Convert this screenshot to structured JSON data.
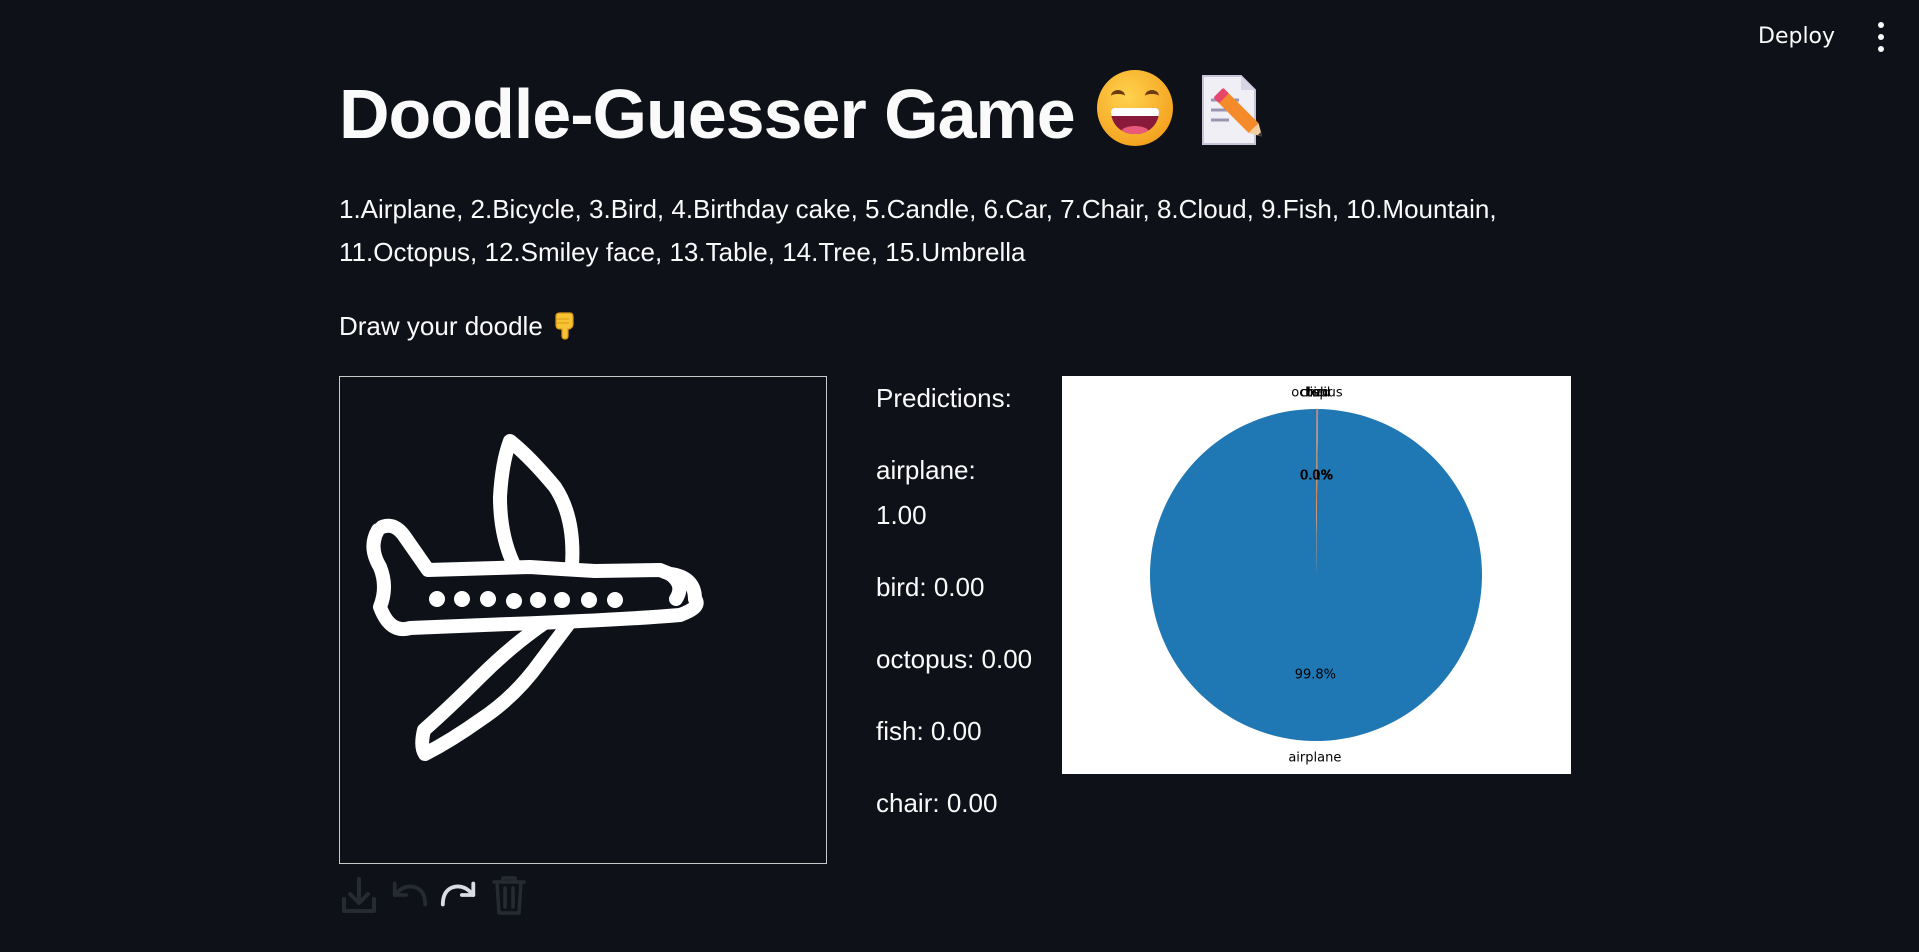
{
  "header": {
    "deploy_label": "Deploy",
    "menu_icon": "vertical-ellipsis-icon"
  },
  "main": {
    "title": "Doodle-Guesser Game",
    "title_emojis": [
      "grinning-face-icon",
      "memo-icon"
    ],
    "classes_text": "1.Airplane, 2.Bicycle, 3.Bird, 4.Birthday cake, 5.Candle, 6.Car, 7.Chair, 8.Cloud, 9.Fish, 10.Mountain, 11.Octopus, 12.Smiley face, 13.Table, 14.Tree, 15.Umbrella",
    "draw_label": "Draw your doodle",
    "draw_emoji": "pointing-down-icon"
  },
  "toolbar": {
    "icons": [
      "download-icon",
      "undo-icon",
      "redo-icon",
      "trash-icon"
    ]
  },
  "predictions": {
    "heading": "Predictions:",
    "items": [
      {
        "label": "airplane:",
        "value": "1.00"
      },
      {
        "label": "bird:",
        "value": "0.00"
      },
      {
        "label": "octopus:",
        "value": "0.00"
      },
      {
        "label": "fish:",
        "value": "0.00"
      },
      {
        "label": "chair:",
        "value": "0.00"
      }
    ]
  },
  "chart_data": {
    "type": "pie",
    "slices": [
      {
        "label": "airplane",
        "value": 99.8,
        "pct_label": "99.8%",
        "color": "#1f77b4"
      },
      {
        "label": "bird",
        "value": 0.1,
        "pct_label": "0.1%",
        "color": "#ff7f0e"
      },
      {
        "label": "octopus",
        "value": 0.03,
        "pct_label": "0.0%",
        "color": "#2ca02c"
      },
      {
        "label": "fish",
        "value": 0.03,
        "pct_label": "0.0%",
        "color": "#d62728"
      },
      {
        "label": "chair",
        "value": 0.04,
        "pct_label": "0.0%",
        "color": "#9467bd"
      }
    ],
    "startangle_deg": 90,
    "counterclock": true,
    "title": "",
    "legend": "none"
  },
  "colors": {
    "background": "#0e1117",
    "text": "#fafafa"
  }
}
